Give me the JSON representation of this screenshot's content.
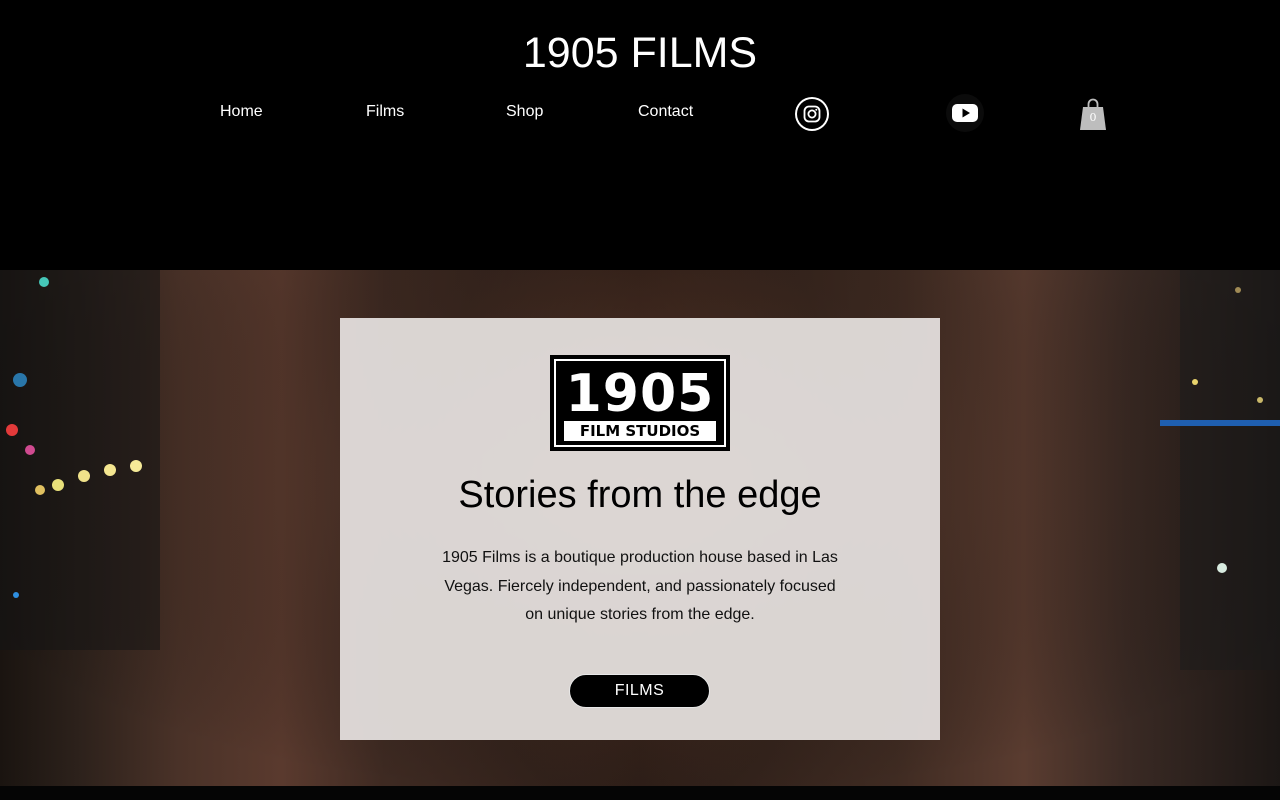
{
  "header": {
    "site_title": "1905 FILMS",
    "nav": [
      {
        "label": "Home"
      },
      {
        "label": "Films"
      },
      {
        "label": "Shop"
      },
      {
        "label": "Contact"
      }
    ],
    "social": [
      {
        "icon": "instagram-icon"
      },
      {
        "icon": "youtube-icon"
      }
    ],
    "cart": {
      "icon": "shopping-bag-icon",
      "count": "0"
    }
  },
  "hero": {
    "logo": {
      "year": "1905",
      "subtitle": "FILM STUDIOS"
    },
    "headline": "Stories from the edge",
    "description": "1905 Films is a boutique production house based in Las Vegas. Fiercely independent, and passionately focused on unique stories from the edge.",
    "button_label": "FILMS"
  },
  "colors": {
    "header_bg": "#000000",
    "card_bg": "#e4e0de",
    "button_bg": "#000000",
    "text_light": "#ffffff"
  }
}
